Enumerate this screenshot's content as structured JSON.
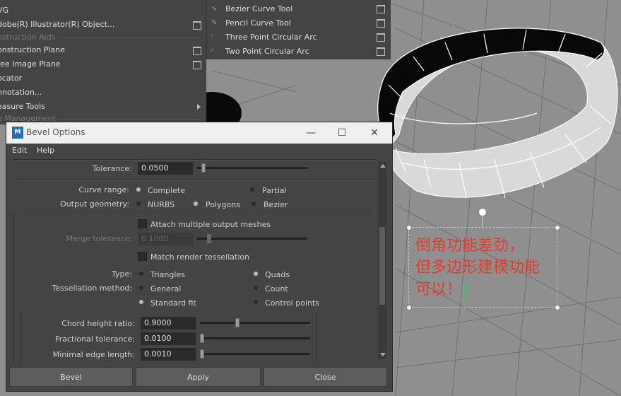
{
  "create_menu": {
    "items": [
      {
        "label": "VG",
        "type": "item"
      },
      {
        "label": "dobe(R) Illustrator(R) Object...",
        "type": "item",
        "option_box": true
      },
      {
        "label": "nstruction Aids",
        "type": "section"
      },
      {
        "label": "onstruction Plane",
        "type": "item",
        "option_box": true
      },
      {
        "label": "ree Image Plane",
        "type": "item",
        "option_box": true
      },
      {
        "label": "ocator",
        "type": "item"
      },
      {
        "label": "nnotation...",
        "type": "item"
      },
      {
        "label": "easure Tools",
        "type": "item",
        "submenu": true
      },
      {
        "label": "e Management",
        "type": "section"
      }
    ]
  },
  "curve_menu": {
    "items": [
      {
        "label": "Bezier Curve Tool",
        "icon": "bezier-curve-icon"
      },
      {
        "label": "Pencil Curve Tool",
        "icon": "pencil-curve-icon"
      },
      {
        "label": "Three Point Circular Arc",
        "icon": "three-point-arc-icon"
      },
      {
        "label": "Two Point Circular Arc",
        "icon": "two-point-arc-icon"
      }
    ]
  },
  "dialog": {
    "title": "Bevel Options",
    "menu": [
      "Edit",
      "Help"
    ],
    "tolerance": {
      "label": "Tolerance:",
      "value": "0.0500"
    },
    "curve_range": {
      "label": "Curve range:",
      "options": [
        "Complete",
        "Partial"
      ],
      "selected": "Complete"
    },
    "output_geometry": {
      "label": "Output geometry:",
      "options": [
        "NURBS",
        "Polygons",
        "Bezier"
      ],
      "selected": "Polygons"
    },
    "attach_multiple": {
      "label": "Attach multiple output meshes"
    },
    "merge_tolerance": {
      "label": "Merge tolerance:",
      "value": "0.1000"
    },
    "match_render": {
      "label": "Match render tessellation"
    },
    "type": {
      "label": "Type:",
      "options": [
        "Triangles",
        "Quads"
      ],
      "selected": "Quads"
    },
    "tessellation_method": {
      "label": "Tessellation method:",
      "options": [
        "General",
        "Count",
        "Standard fit",
        "Control points"
      ],
      "selected": "Standard fit"
    },
    "chord_height_ratio": {
      "label": "Chord height ratio:",
      "value": "0.9000"
    },
    "fractional_tolerance": {
      "label": "Fractional tolerance:",
      "value": "0.0100"
    },
    "minimal_edge_length": {
      "label": "Minimal edge length:",
      "value": "0.0010"
    },
    "buttons": {
      "bevel": "Bevel",
      "apply": "Apply",
      "close": "Close"
    }
  },
  "annotation": {
    "lines": [
      "倒角功能差劲，",
      "但多边形建模功能",
      "可以！"
    ],
    "color": "#e63a2b"
  },
  "window_controls": {
    "minimize": "—",
    "maximize": "☐",
    "close": "✕"
  },
  "logo_text": "M"
}
